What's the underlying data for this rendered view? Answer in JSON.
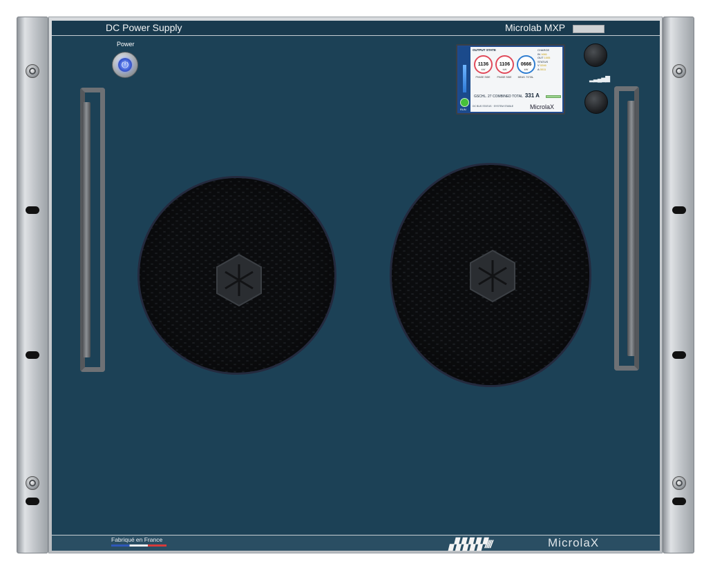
{
  "header": {
    "product_type": "DC Power Supply",
    "model": "Microlab MXP"
  },
  "power_button": {
    "label": "Power",
    "icon": "power-icon"
  },
  "display": {
    "header": "OUTPUT STATE",
    "gauges": [
      {
        "value": "1136",
        "unit": "kW",
        "label": "PHASE SIDE"
      },
      {
        "value": "1106",
        "unit": "kW",
        "label": "PHASE SIDE"
      },
      {
        "value": "0666",
        "unit": "kW",
        "label": "MEAS. TOTAL"
      }
    ],
    "right_panel": {
      "title1": "CHARGE",
      "row1a_label": "IN",
      "row1a_value": "1661",
      "row1b_label": "OUT",
      "row1b_value": "1005",
      "title2": "STATUS",
      "row2a_label": "V",
      "row2a_value": "0246",
      "row2b_label": "A",
      "row2b_value": "0011"
    },
    "total_label": "GSCHL. 27   COMBINED TOTAL",
    "total_value": "331 A",
    "footer": "DC BUS STATUS · SYSTEM STABLE",
    "brand": "MicrolaX",
    "run_label": "RUN"
  },
  "signal_indicator": "▂▃▄▅▇",
  "footer": {
    "made_in": "Fabriqué en France",
    "stripes": "▞▞▞▞▞////",
    "brand": "MicrolaX"
  },
  "colors": {
    "panel": "#1c4156",
    "rack": "#c3c7cb",
    "power_led": "#4060d8"
  }
}
